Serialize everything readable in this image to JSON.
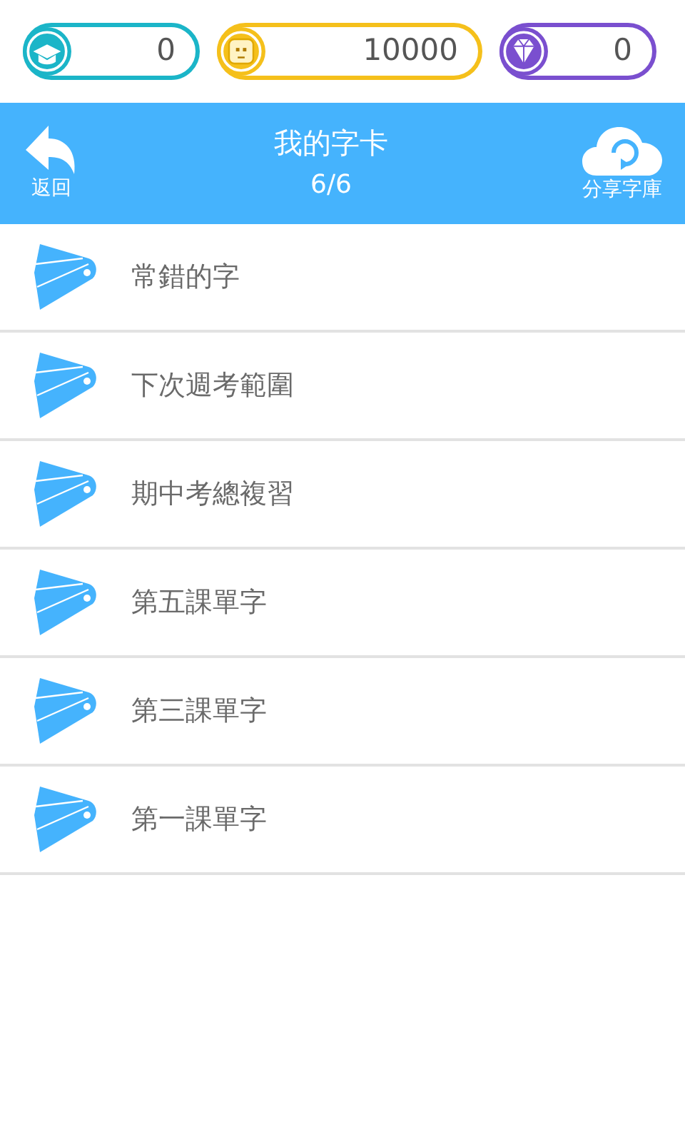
{
  "counters": [
    {
      "kind": "cap",
      "color": "#1bb5c8",
      "value": "0"
    },
    {
      "kind": "coin",
      "color": "#f5c01b",
      "value": "10000"
    },
    {
      "kind": "diamond",
      "color": "#7a4fcf",
      "value": "0"
    }
  ],
  "header": {
    "back_label": "返回",
    "title": "我的字卡",
    "count": "6/6",
    "share_label": "分享字庫"
  },
  "decks": [
    {
      "name": "常錯的字"
    },
    {
      "name": "下次週考範圍"
    },
    {
      "name": "期中考總複習"
    },
    {
      "name": "第五課單字"
    },
    {
      "name": "第三課單字"
    },
    {
      "name": "第一課單字"
    }
  ]
}
